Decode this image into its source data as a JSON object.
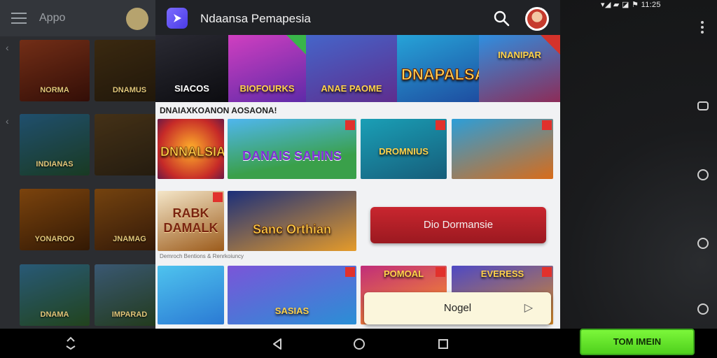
{
  "left_drawer": {
    "title": "Appo",
    "tiles": [
      "NORMA",
      "DNAMUS",
      "INDIANAS",
      "",
      "YONAROO",
      "JNAMAG",
      "DNAMA",
      "IMPARAD"
    ]
  },
  "panel": {
    "app_title": "Ndaansa Pemapesia",
    "banner": [
      "SIACOS",
      "BIOFOURKS",
      "ANAE PAOME",
      "DNAPALSA",
      "INANIPAR"
    ],
    "section_title": "DNAIAXKOANON AOSAONA!",
    "row1": [
      "DNNALSIA",
      "DANAIS SAHINS",
      "DROMNIUS",
      ""
    ],
    "row2": [
      "RABK DAMALK",
      "Sanc Orthian"
    ],
    "promo_button": "Dio Dormansie",
    "sub_caption": "Demroch Bentions & Renrkoiuncy",
    "row3": [
      "",
      "SASIAS",
      "POMOAL",
      "EVERESS"
    ],
    "toast": "Nogel"
  },
  "status_bar": "▾◢ ▰ ◪ ⚑ 11:25",
  "cta": "TOM IMEIN",
  "colors": {
    "panel_topbar": "#202226",
    "promo": "#b11f28",
    "cta": "#5bde24",
    "ribbon": "#d4322b"
  },
  "icons": [
    "menu-icon",
    "search-icon",
    "app-logo-icon",
    "more-vert-icon",
    "rotate-icon",
    "back-icon",
    "home-icon",
    "recent-apps-icon"
  ]
}
